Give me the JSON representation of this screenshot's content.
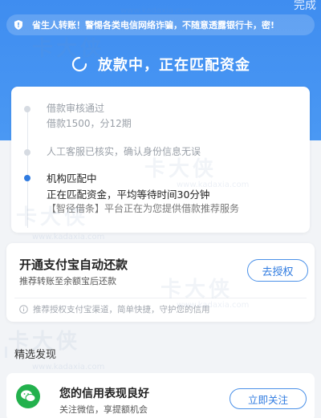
{
  "header": {
    "top_action": "完成",
    "notice": "省生人转账！警惕各类电信网络诈骗，不随意透露银行卡，密!",
    "status_title": "放款中，正在匹配资金"
  },
  "timeline": {
    "step1": {
      "title": "借款审核通过",
      "detail": "借款1500，分12期"
    },
    "step2": {
      "title": "人工客服已核实，确认身份信息无误"
    },
    "step3": {
      "title": "机构匹配中",
      "detail": "正在匹配资金，平均等待时间30分钟",
      "note": "【智径借条】平台正在为您提供借款推荐服务"
    }
  },
  "autopay": {
    "title": "开通支付宝自动还款",
    "subtitle": "推荐转账至余额宝后还款",
    "button": "去授权",
    "tip": "推荐授权支付宝渠道，简单快捷，守护您的信用"
  },
  "section": {
    "title": "精选发现"
  },
  "follow": {
    "title": "您的信用表现良好",
    "subtitle": "关注微信，享提额机会",
    "button": "立即关注"
  },
  "watermark": {
    "brand": "卡大侠",
    "url": "www.kadaxia.com"
  },
  "colors": {
    "primary": "#4a98f3",
    "accent_blue": "#2f7be0",
    "wechat_green": "#23b14d"
  }
}
